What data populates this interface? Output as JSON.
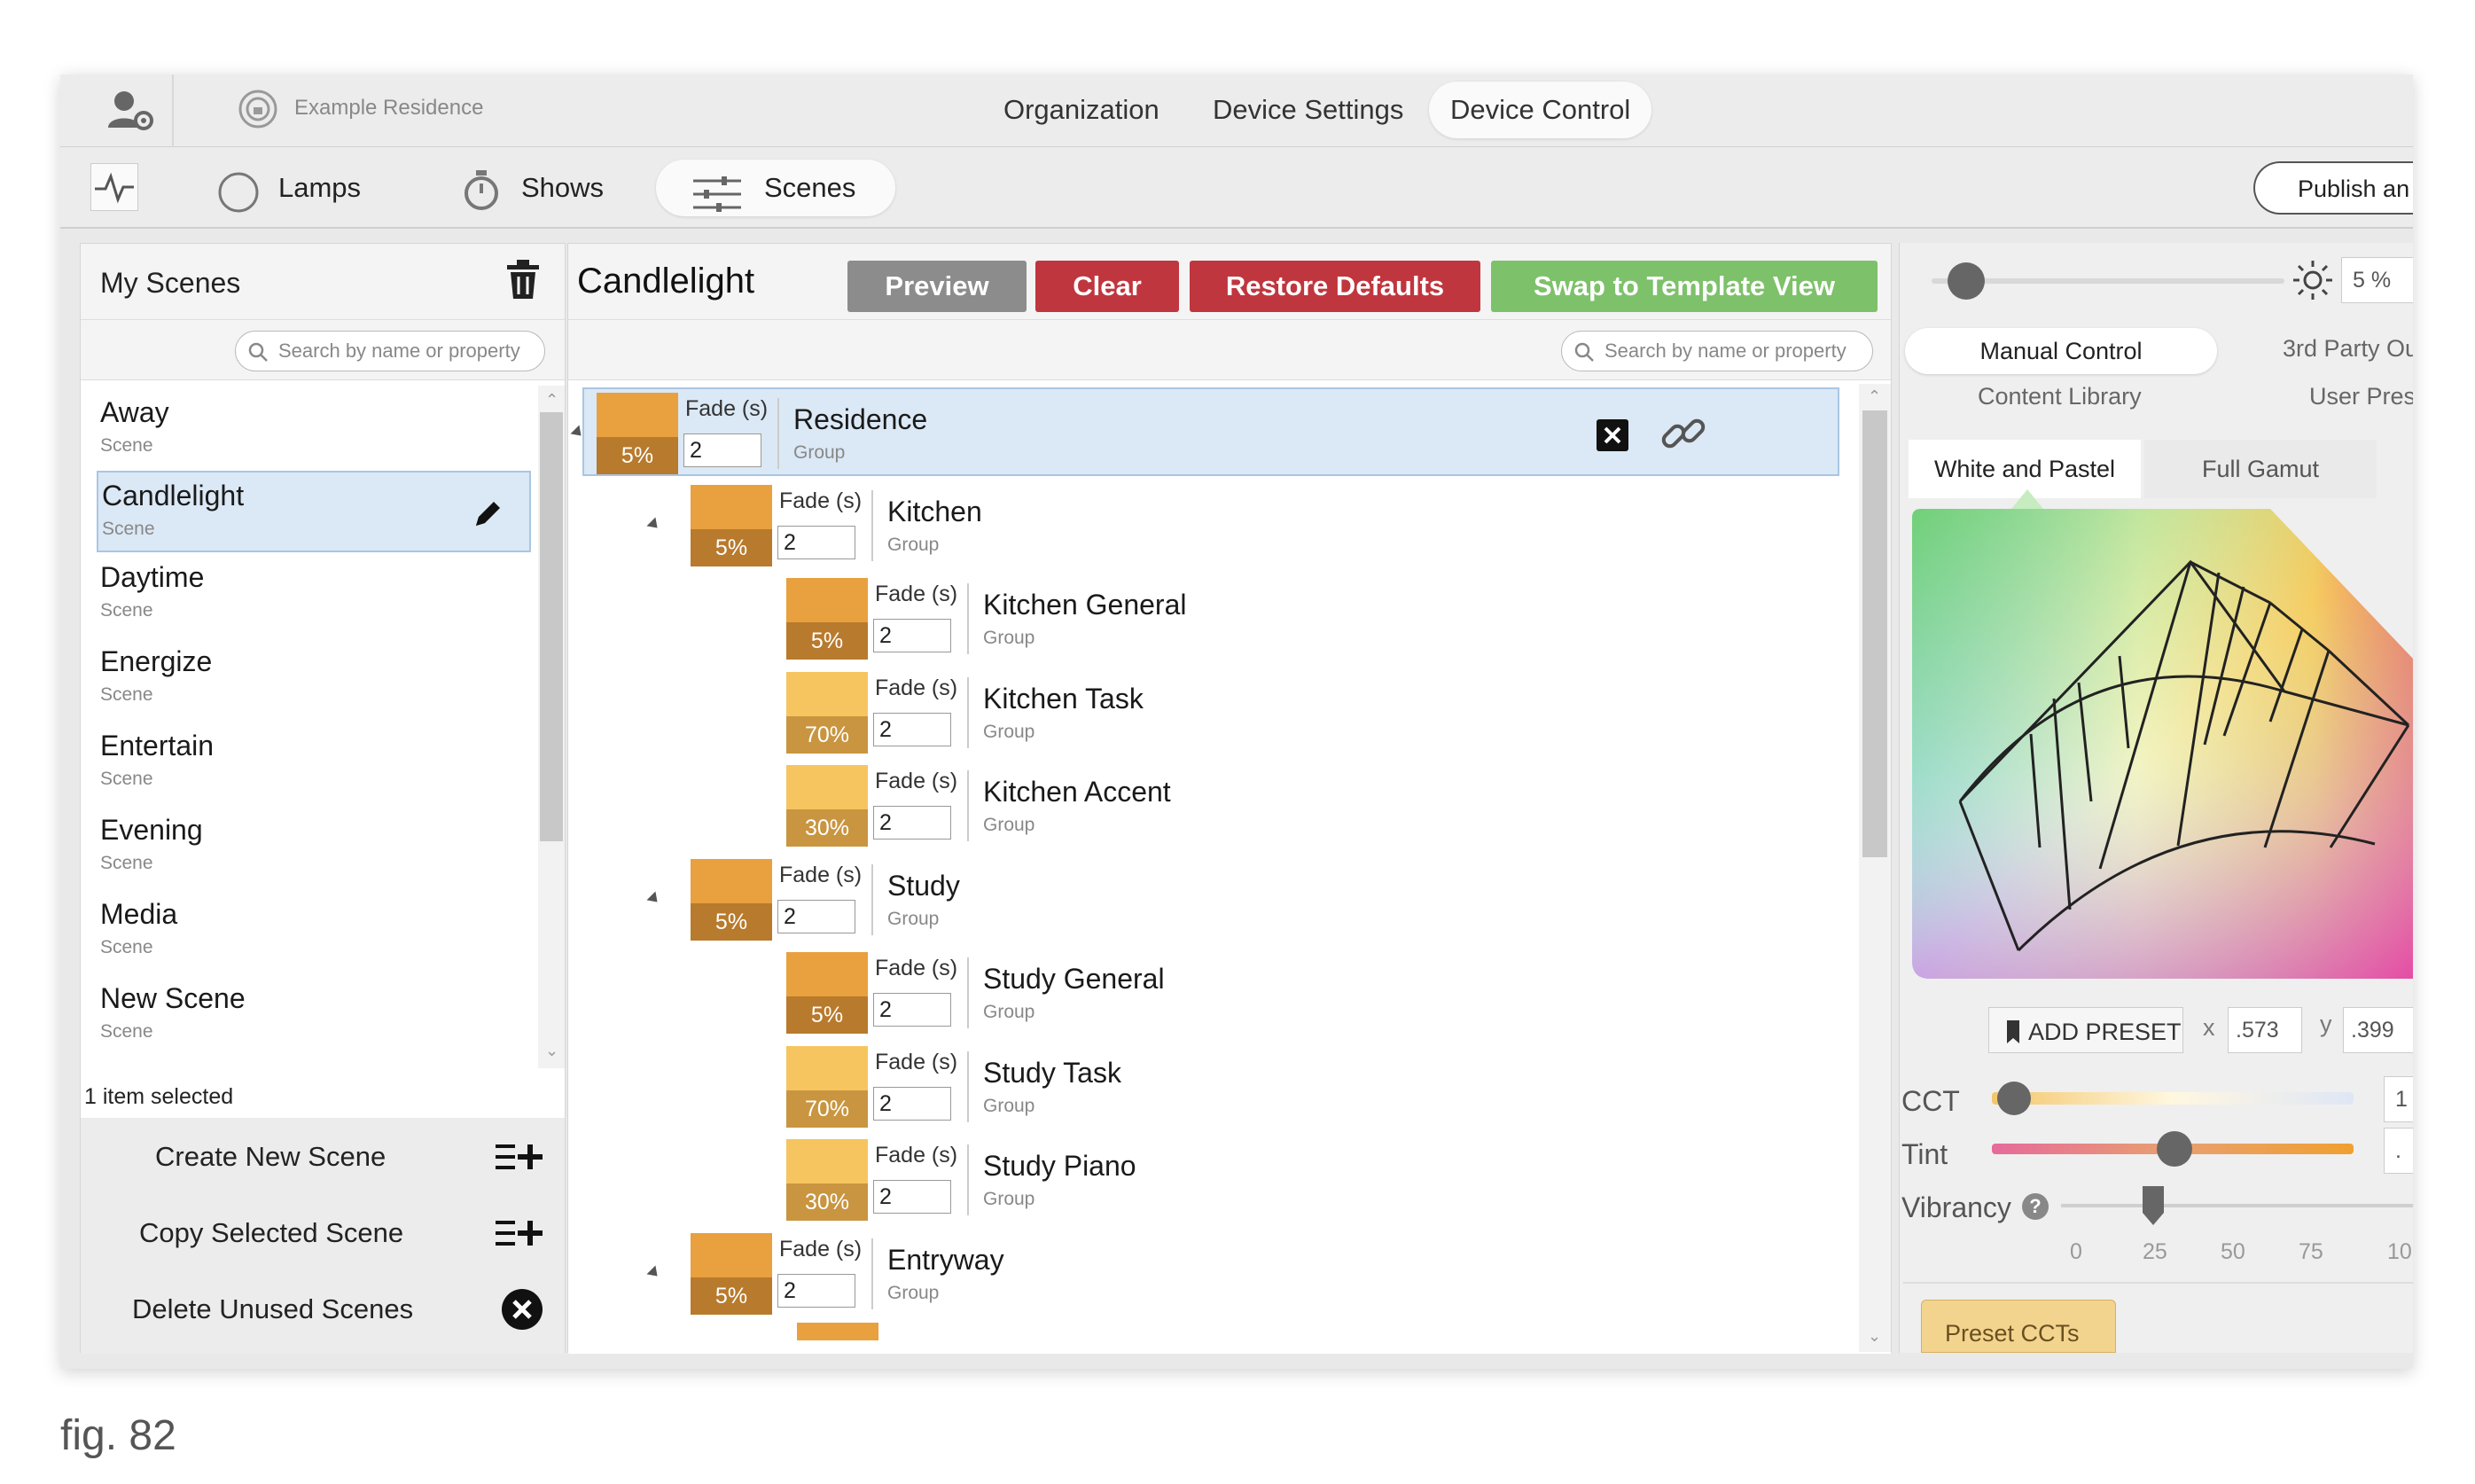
{
  "header": {
    "residence": "Example Residence",
    "nav_tabs": [
      "Organization",
      "Device Settings",
      "Device Control"
    ],
    "active_nav": "Device Control"
  },
  "subnav": {
    "tabs": [
      "Lamps",
      "Shows",
      "Scenes"
    ],
    "active": "Scenes",
    "publish_label": "Publish an"
  },
  "scenes_panel": {
    "title": "My Scenes",
    "search_placeholder": "Search by name or property",
    "items": [
      {
        "name": "Away",
        "type": "Scene"
      },
      {
        "name": "Candlelight",
        "type": "Scene"
      },
      {
        "name": "Daytime",
        "type": "Scene"
      },
      {
        "name": "Energize",
        "type": "Scene"
      },
      {
        "name": "Entertain",
        "type": "Scene"
      },
      {
        "name": "Evening",
        "type": "Scene"
      },
      {
        "name": "Media",
        "type": "Scene"
      },
      {
        "name": "New Scene",
        "type": "Scene"
      }
    ],
    "selected": "Candlelight",
    "status": "1 item selected",
    "actions": [
      "Create New Scene",
      "Copy Selected Scene",
      "Delete Unused Scenes"
    ]
  },
  "editor": {
    "title": "Candlelight",
    "buttons": [
      "Preview",
      "Clear",
      "Restore Defaults",
      "Swap to Template View"
    ],
    "search_placeholder": "Search by name or property",
    "fade_label": "Fade (s)",
    "rows": [
      {
        "name": "Residence",
        "type": "Group",
        "level": 0,
        "fade": "2",
        "intensity": "5%",
        "shade": "dark"
      },
      {
        "name": "Kitchen",
        "type": "Group",
        "level": 1,
        "fade": "2",
        "intensity": "5%",
        "shade": "dark"
      },
      {
        "name": "Kitchen General",
        "type": "Group",
        "level": 2,
        "fade": "2",
        "intensity": "5%",
        "shade": "dark"
      },
      {
        "name": "Kitchen Task",
        "type": "Group",
        "level": 2,
        "fade": "2",
        "intensity": "70%",
        "shade": "light"
      },
      {
        "name": "Kitchen Accent",
        "type": "Group",
        "level": 2,
        "fade": "2",
        "intensity": "30%",
        "shade": "light"
      },
      {
        "name": "Study",
        "type": "Group",
        "level": 1,
        "fade": "2",
        "intensity": "5%",
        "shade": "dark"
      },
      {
        "name": "Study General",
        "type": "Group",
        "level": 2,
        "fade": "2",
        "intensity": "5%",
        "shade": "dark"
      },
      {
        "name": "Study Task",
        "type": "Group",
        "level": 2,
        "fade": "2",
        "intensity": "70%",
        "shade": "light"
      },
      {
        "name": "Study Piano",
        "type": "Group",
        "level": 2,
        "fade": "2",
        "intensity": "30%",
        "shade": "light"
      },
      {
        "name": "Entryway",
        "type": "Group",
        "level": 1,
        "fade": "2",
        "intensity": "5%",
        "shade": "dark"
      }
    ]
  },
  "control_panel": {
    "intensity": "5 %",
    "intensity_fraction": 0.05,
    "tabs_row1": [
      "Manual Control",
      "3rd Party Ou"
    ],
    "tabs_row2": [
      "Content Library",
      "User Prese"
    ],
    "color_tabs": [
      "White and Pastel",
      "Full Gamut"
    ],
    "add_preset": "ADD PRESET",
    "x_label": "x",
    "x_value": ".573",
    "y_label": "y",
    "y_value": ".399",
    "cct_label": "CCT",
    "cct_value": "1",
    "tint_label": "Tint",
    "tint_value": ".",
    "vibrancy_label": "Vibrancy",
    "vibrancy_ticks": [
      "0",
      "25",
      "50",
      "75",
      "10"
    ],
    "preset_cct_label": "Preset CCTs"
  },
  "caption": "fig. 82",
  "colors": {
    "dark_top": "#e9a03e",
    "dark_bottom": "#b87a2c",
    "light_top": "#f6c560",
    "light_bottom": "#c99540",
    "preview": "#8c8c8c",
    "clear": "#c0363e",
    "restore": "#c0363e",
    "swap": "#7dc16a"
  }
}
